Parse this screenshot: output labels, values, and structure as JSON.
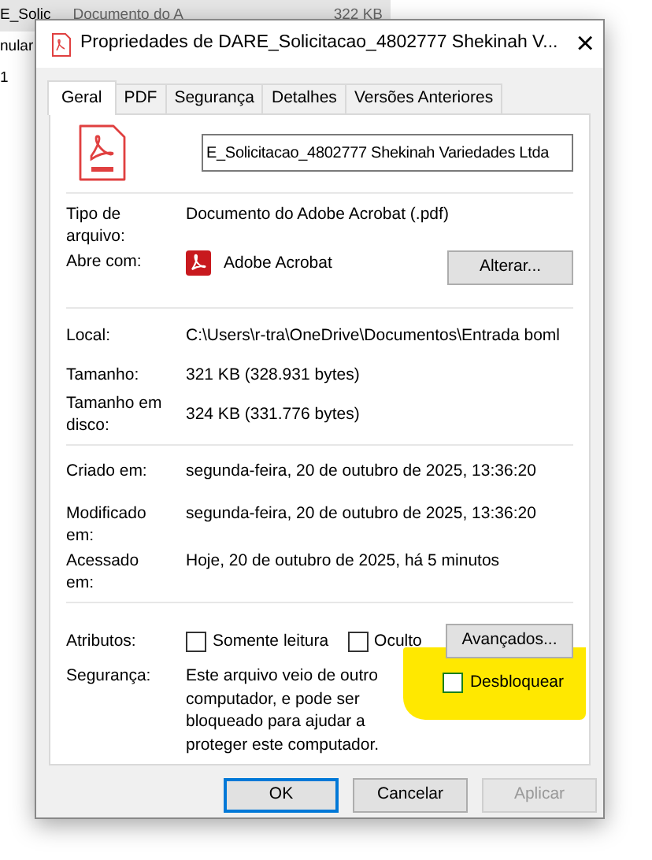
{
  "background_list": {
    "rows": [
      {
        "name": "E_Solic",
        "type": "Documento do A",
        "size": "322 KB",
        "selected": true
      },
      {
        "name": "nular",
        "selected": false
      },
      {
        "name": "1",
        "selected": false
      }
    ]
  },
  "window": {
    "title": "Propriedades de DARE_Solicitacao_4802777 Shekinah V...",
    "close": "×"
  },
  "tabs": [
    {
      "label": "Geral",
      "selected": true
    },
    {
      "label": "PDF",
      "selected": false
    },
    {
      "label": "Segurança",
      "selected": false
    },
    {
      "label": "Detalhes",
      "selected": false
    },
    {
      "label": "Versões Anteriores",
      "selected": false
    }
  ],
  "file_name": {
    "value": "E_Solicitacao_4802777 Shekinah Variedades Ltda"
  },
  "type_section": [
    {
      "label": "Tipo de arquivo:",
      "value": "Documento do Adobe Acrobat (.pdf)"
    },
    {
      "label": "Abre com:",
      "value": "Adobe Acrobat",
      "button": "Alterar..."
    }
  ],
  "location_section": [
    {
      "label": "Local:",
      "value": "C:\\Users\\r-tra\\OneDrive\\Documentos\\Entrada boml"
    },
    {
      "label": "Tamanho:",
      "value": "321 KB (328.931 bytes)"
    },
    {
      "label": "Tamanho em disco:",
      "value": "324 KB (331.776 bytes)"
    }
  ],
  "dates_section": [
    {
      "label": "Criado em:",
      "value": "segunda-feira, 20 de outubro de 2025, 13:36:20"
    },
    {
      "label": "Modificado em:",
      "value": "segunda-feira, 20 de outubro de 2025, 13:36:20"
    },
    {
      "label": "Acessado em:",
      "value": "Hoje, 20 de outubro de 2025, há 5 minutos"
    }
  ],
  "attributes": {
    "label": "Atributos:",
    "checkboxes": [
      {
        "label": "Somente leitura",
        "checked": false
      },
      {
        "label": "Oculto",
        "checked": false
      }
    ],
    "button": "Avançados..."
  },
  "security": {
    "label": "Segurança:",
    "text": "Este arquivo veio de outro computador, e pode ser bloqueado para ajudar a proteger este computador.",
    "checkbox": {
      "label": "Desbloquear",
      "checked": false
    },
    "highlighted": true
  },
  "buttons": [
    {
      "label": "OK",
      "default": true,
      "disabled": false
    },
    {
      "label": "Cancelar",
      "default": false,
      "disabled": false
    },
    {
      "label": "Aplicar",
      "default": false,
      "disabled": true
    }
  ]
}
